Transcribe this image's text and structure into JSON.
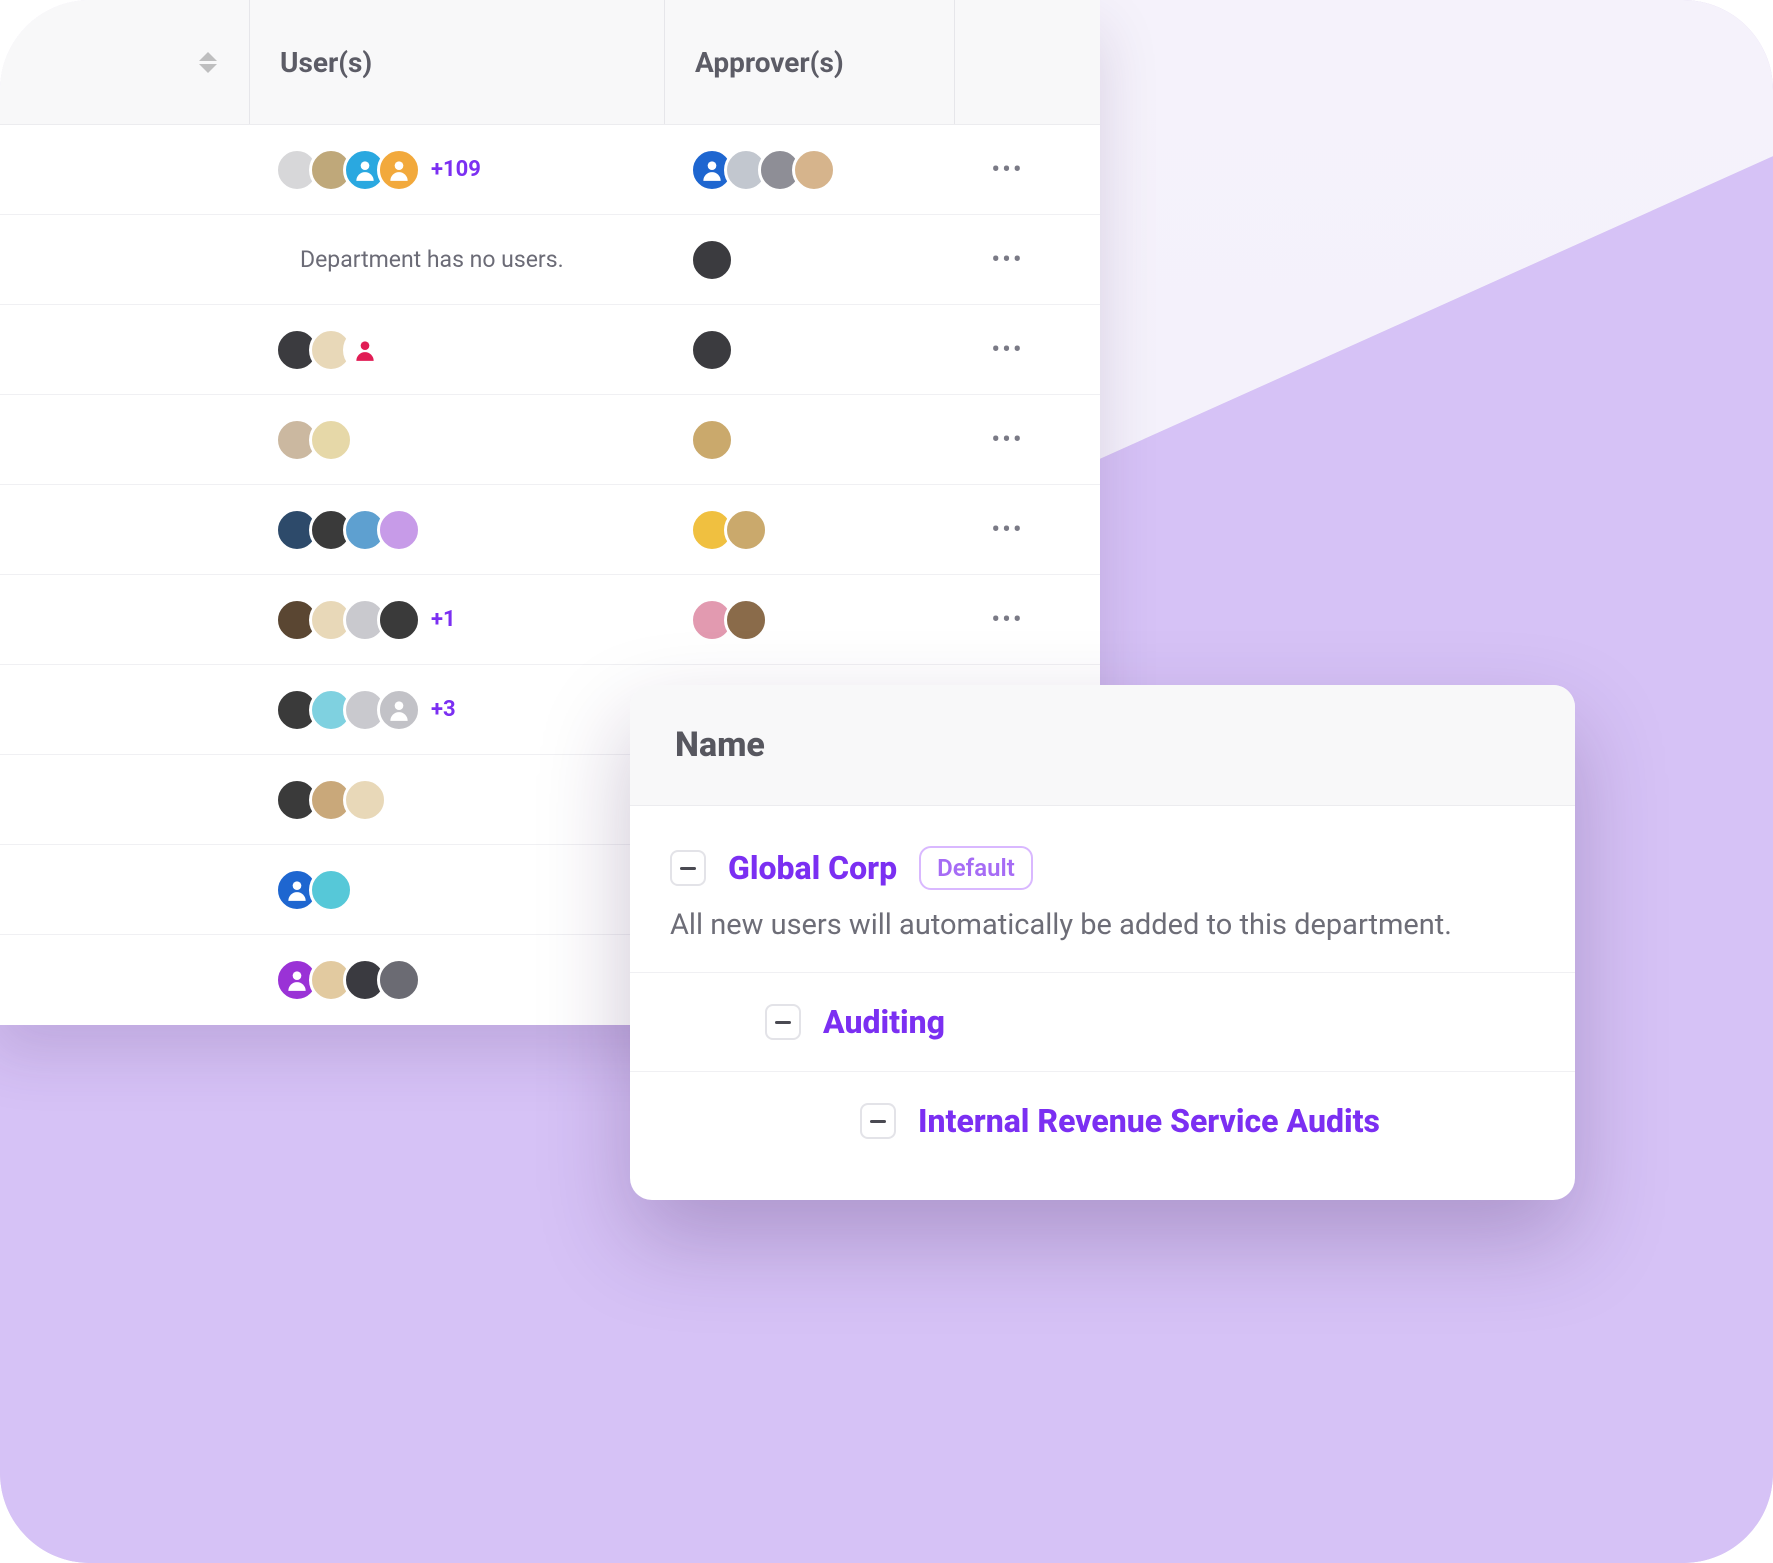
{
  "table": {
    "headers": {
      "users": "User(s)",
      "approvers": "Approver(s)"
    },
    "empty_row_text": "Department has no users.",
    "rows": [
      {
        "users_count": 4,
        "overflow": "+109",
        "approvers_count": 4
      },
      {
        "empty": true,
        "approvers_count": 1
      },
      {
        "users_count": 3,
        "approvers_count": 1
      },
      {
        "users_count": 2,
        "approvers_count": 1
      },
      {
        "users_count": 4,
        "approvers_count": 2
      },
      {
        "users_count": 4,
        "overflow": "+1",
        "approvers_count": 2
      },
      {
        "users_count": 4,
        "overflow": "+3",
        "approvers_count": 0
      },
      {
        "users_count": 3,
        "approvers_count": 0
      },
      {
        "users_count": 2,
        "approvers_count": 0
      },
      {
        "users_count": 4,
        "approvers_count": 0
      }
    ]
  },
  "tree": {
    "header": "Name",
    "nodes": [
      {
        "name": "Global Corp",
        "badge": "Default",
        "subtitle": "All new users will automatically be added to this department.",
        "indent": 0
      },
      {
        "name": "Auditing",
        "indent": 1
      },
      {
        "name": "Internal Revenue Service Audits",
        "indent": 2
      }
    ]
  }
}
